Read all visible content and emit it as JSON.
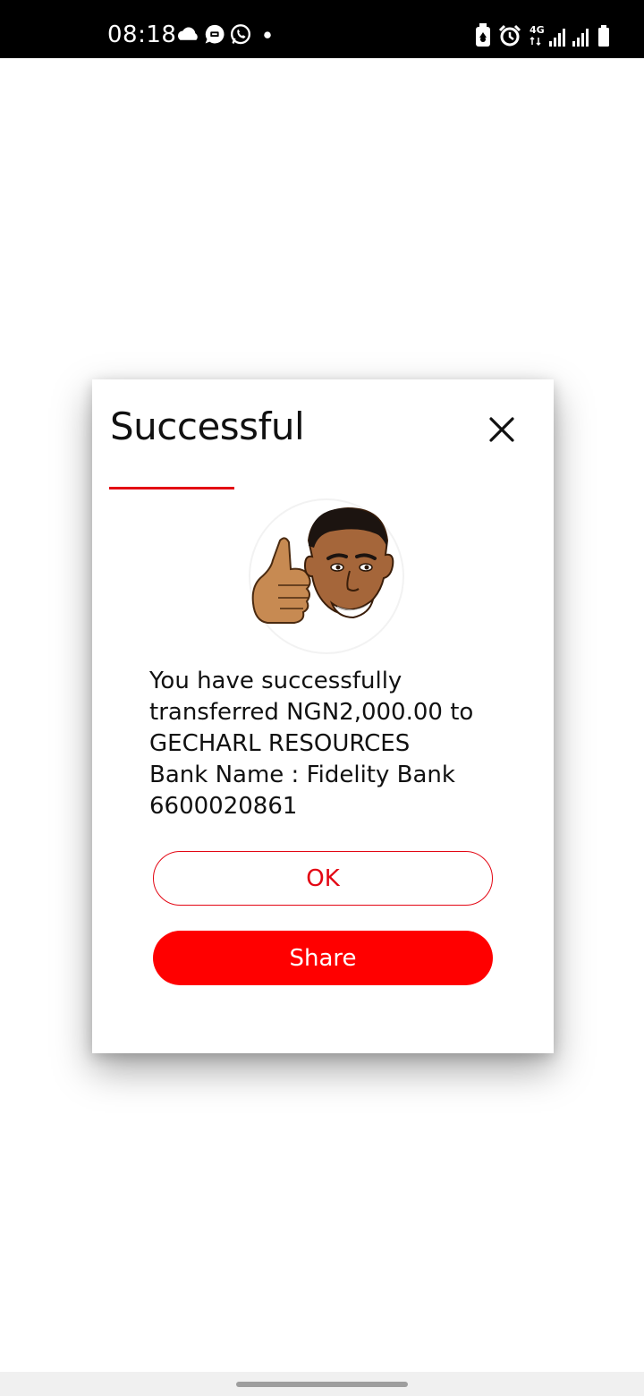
{
  "status_bar": {
    "time": "08:18",
    "network": "4G",
    "left_icons": [
      "cloud-icon",
      "chat-icon",
      "whatsapp-icon",
      "dot-icon"
    ],
    "right_icons": [
      "battery-saver-icon",
      "alarm-icon",
      "network-4g-icon",
      "signal-icon",
      "signal-icon",
      "battery-icon"
    ]
  },
  "dialog": {
    "title": "Successful",
    "accent_color": "#e30613",
    "message_lines": [
      "You have successfully",
      "transferred NGN2,000.00 to",
      "GECHARL RESOURCES",
      "Bank Name : Fidelity Bank",
      "6600020861"
    ],
    "ok_label": "OK",
    "share_label": "Share",
    "share_color": "#ff0000"
  }
}
